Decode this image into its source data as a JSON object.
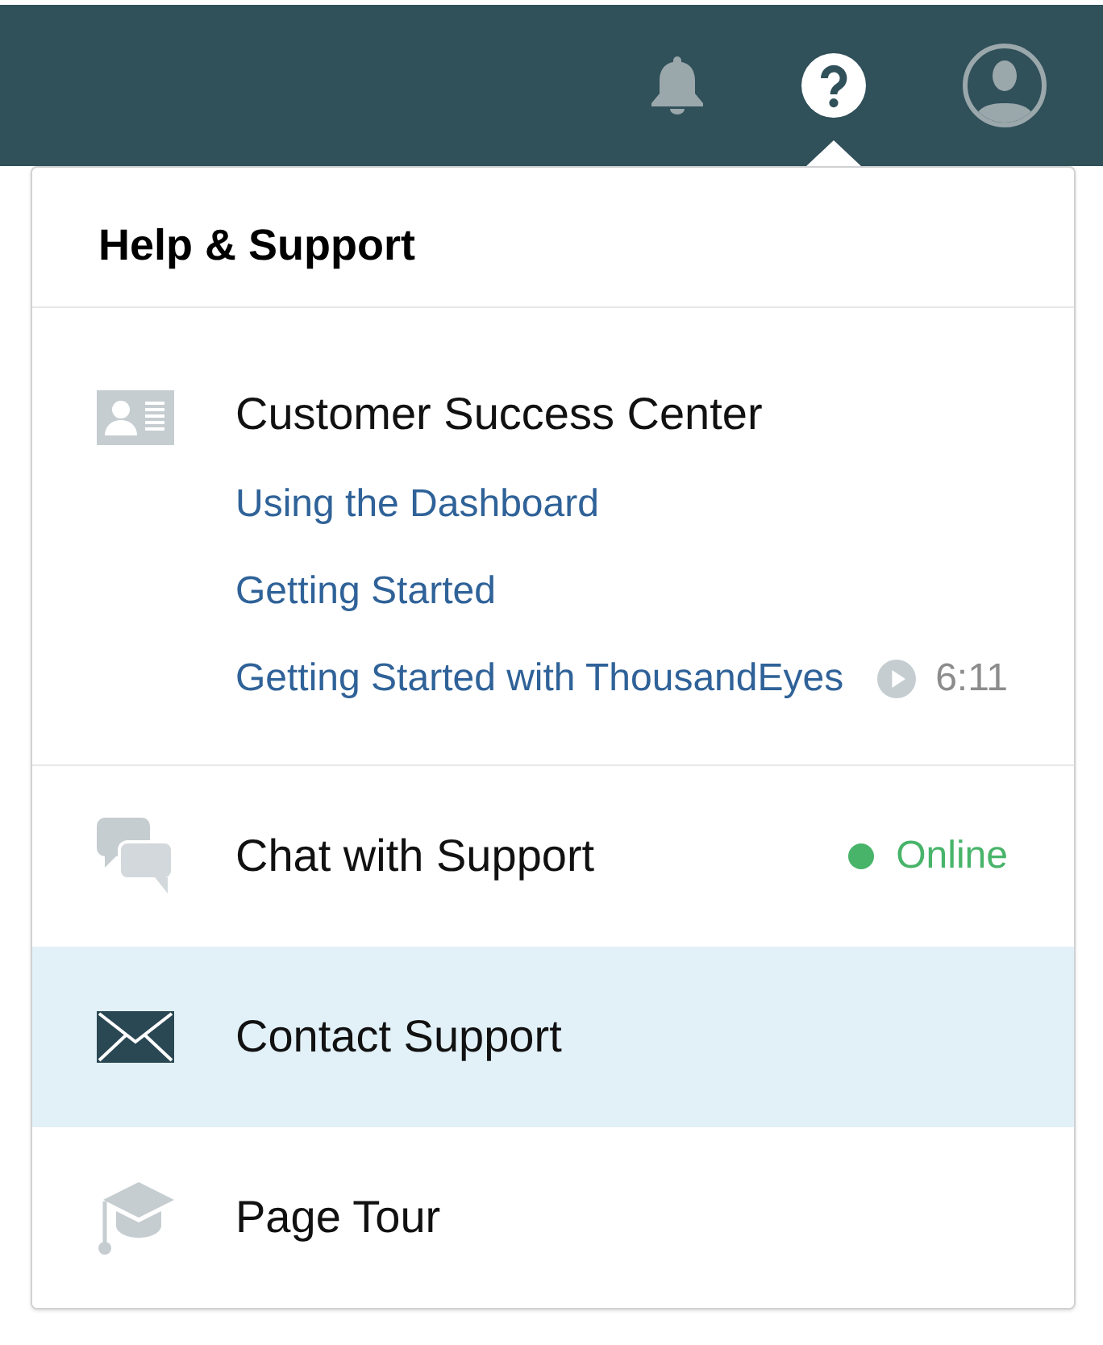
{
  "top_bar": {
    "icons": [
      {
        "kind": "notifications",
        "selected": false
      },
      {
        "kind": "help",
        "selected": true
      },
      {
        "kind": "account",
        "selected": false
      }
    ]
  },
  "help_menu": {
    "title": "Help & Support",
    "resources": {
      "title": "Customer Success Center",
      "links": [
        {
          "label": "Using the Dashboard"
        },
        {
          "label": "Getting Started"
        },
        {
          "label": "Getting Started with ThousandEyes",
          "duration": "6:11"
        }
      ]
    },
    "items": [
      {
        "kind": "chat",
        "label": "Chat with Support",
        "selected": false,
        "status": {
          "label": "Online",
          "color": "#48b46a"
        }
      },
      {
        "kind": "contact",
        "label": "Contact Support",
        "selected": true
      },
      {
        "kind": "tour",
        "label": "Page Tour",
        "selected": false
      }
    ]
  }
}
